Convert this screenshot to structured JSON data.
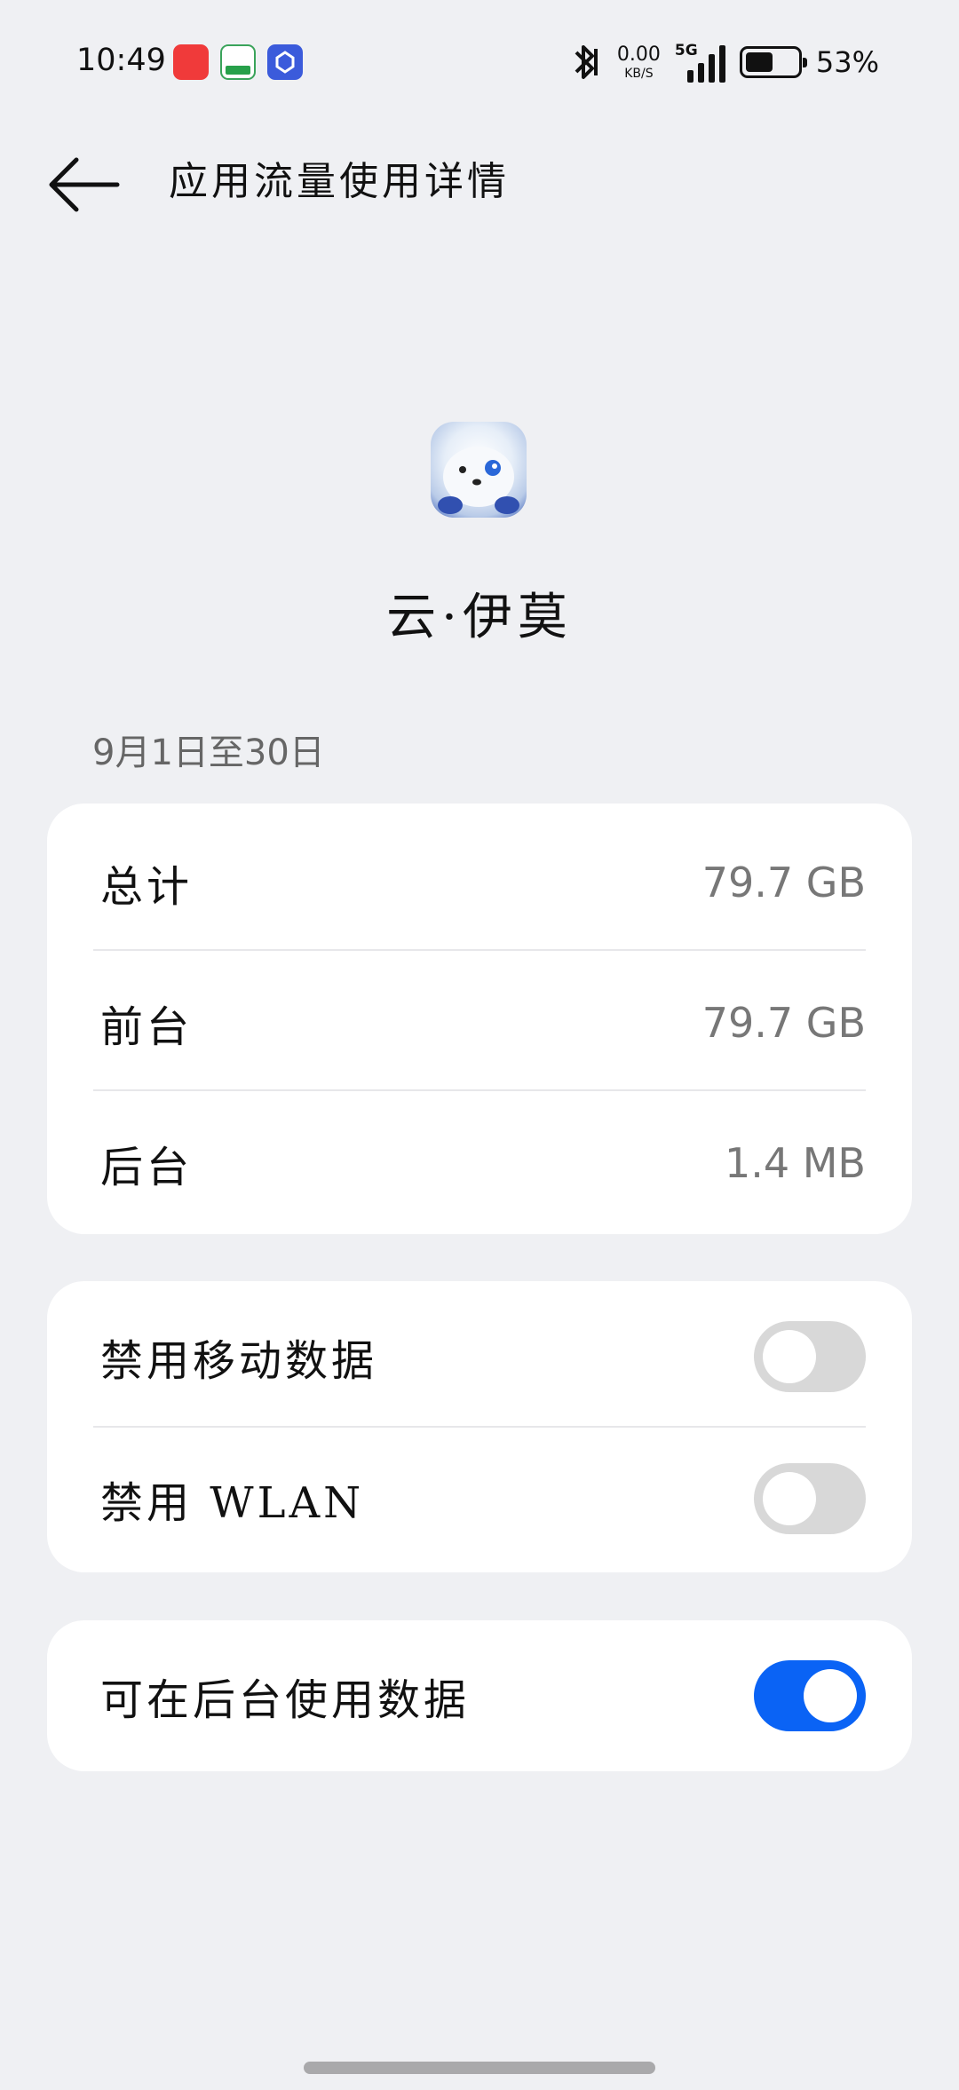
{
  "status_bar": {
    "time": "10:49",
    "net_speed_value": "0.00",
    "net_speed_unit": "KB/S",
    "signal_label": "5G",
    "battery_percent": "53%",
    "battery_level": 0.53,
    "icons": [
      "notification-app-icon",
      "oppo-app-icon",
      "store-app-icon",
      "bluetooth-icon",
      "signal-icon",
      "battery-icon"
    ]
  },
  "header": {
    "title": "应用流量使用详情"
  },
  "app": {
    "name": "云·伊莫"
  },
  "period": {
    "label": "9月1日至30日"
  },
  "usage": {
    "rows": [
      {
        "label": "总计",
        "value": "79.7 GB"
      },
      {
        "label": "前台",
        "value": "79.7 GB"
      },
      {
        "label": "后台",
        "value": "1.4 MB"
      }
    ]
  },
  "restrictions": {
    "rows": [
      {
        "label": "禁用移动数据",
        "enabled": false
      },
      {
        "label": "禁用 WLAN",
        "enabled": false
      }
    ]
  },
  "background": {
    "rows": [
      {
        "label": "可在后台使用数据",
        "enabled": true
      }
    ]
  },
  "colors": {
    "toggle_on": "#0a63f5",
    "toggle_off": "#d8d8d8",
    "background": "#eff0f3"
  }
}
